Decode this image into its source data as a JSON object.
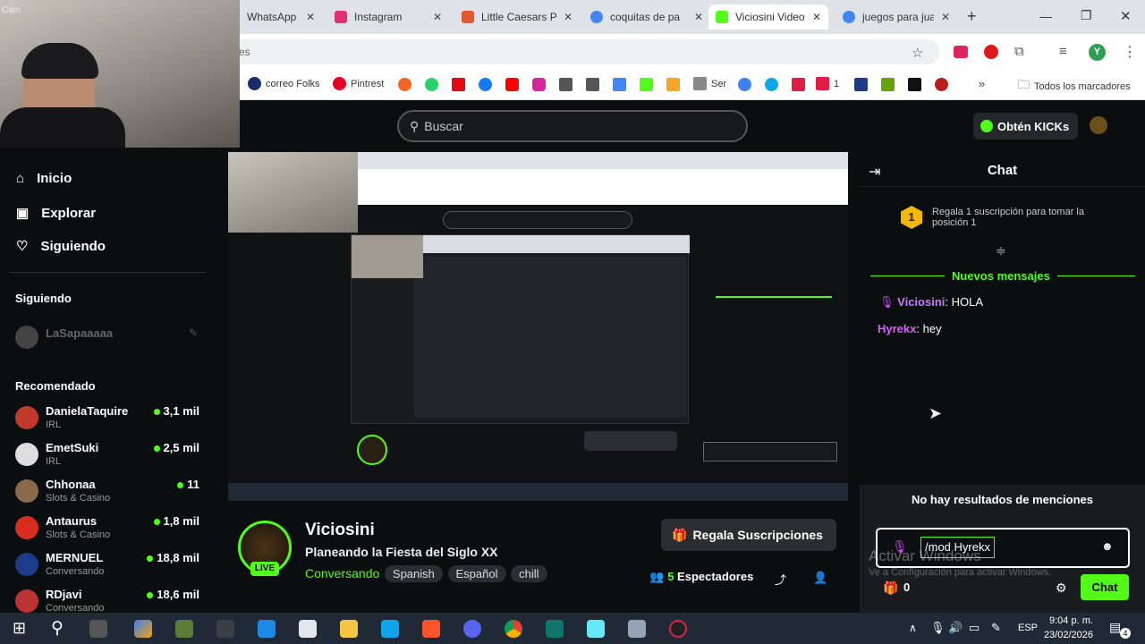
{
  "browser": {
    "tabs": [
      {
        "label": "WhatsApp",
        "color": "#25d366"
      },
      {
        "label": "Instagram",
        "color": "#e1306c"
      },
      {
        "label": "Little Caesars P",
        "color": "#e4572e"
      },
      {
        "label": "coquitas de pa",
        "color": "#4285f4"
      },
      {
        "label": "Viciosini Video",
        "color": "#53fc18"
      },
      {
        "label": "juegos para jua",
        "color": "#4285f4"
      }
    ],
    "new_tab": "+",
    "address": "es",
    "profile_initial": "Y",
    "bookmarks": [
      "correo Folks",
      "Pintrest",
      "Ser",
      "1"
    ],
    "all_bookmarks": "Todos los marcadores"
  },
  "webcam_label": "Cam",
  "kick": {
    "search_placeholder": "Buscar",
    "get_kicks": "Obtén KICKs",
    "nav": [
      {
        "label": "Inicio",
        "icon": "home-icon"
      },
      {
        "label": "Explorar",
        "icon": "compass-icon"
      },
      {
        "label": "Siguiendo",
        "icon": "heart-icon"
      }
    ],
    "following_title": "Siguiendo",
    "following": [
      {
        "name": "LaSapaaaaa"
      }
    ],
    "recommended_title": "Recomendado",
    "recommended": [
      {
        "name": "DanielaTaquire",
        "cat": "IRL",
        "viewers": "3,1 mil",
        "color": "#c0392b"
      },
      {
        "name": "EmetSuki",
        "cat": "IRL",
        "viewers": "2,5 mil",
        "color": "#ddd"
      },
      {
        "name": "Chhonaa",
        "cat": "Slots & Casino",
        "viewers": "11",
        "color": "#8a6a4a"
      },
      {
        "name": "Antaurus",
        "cat": "Slots & Casino",
        "viewers": "1,8 mil",
        "color": "#d62d20"
      },
      {
        "name": "MERNUEL",
        "cat": "Conversando",
        "viewers": "18,8 mil",
        "color": "#1e3a8a"
      },
      {
        "name": "RDjavi",
        "cat": "Conversando",
        "viewers": "18,6 mil",
        "color": "#b33"
      }
    ],
    "stream": {
      "streamer": "Viciosini",
      "live": "LIVE",
      "title": "Planeando la Fiesta del Siglo XX",
      "category": "Conversando",
      "tags": [
        "Spanish",
        "Español",
        "chill"
      ],
      "gift_button": "Regala Suscripciones",
      "viewers_count": "5",
      "viewers_label": "Espectadores"
    },
    "chat": {
      "title": "Chat",
      "gift_rank": "1",
      "gift_prompt": "Regala 1 suscripción para tomar la posición 1",
      "new_messages": "Nuevos mensajes",
      "messages": [
        {
          "user": "Viciosini",
          "text": "HOLA",
          "color": "#c97bff"
        },
        {
          "user": "Hyrekx",
          "text": "hey",
          "color": "#d85cff"
        }
      ],
      "no_mentions": "No hay resultados de menciones",
      "input_value": "/mod Hyrekx",
      "points": "0",
      "send": "Chat",
      "watermark_title": "Activar Windows",
      "watermark_sub": "Ve a Configuración para activar Windows."
    }
  },
  "taskbar": {
    "lang": "ESP",
    "time": "9:04 p. m.",
    "date": "23/02/2026",
    "notif": "4"
  }
}
